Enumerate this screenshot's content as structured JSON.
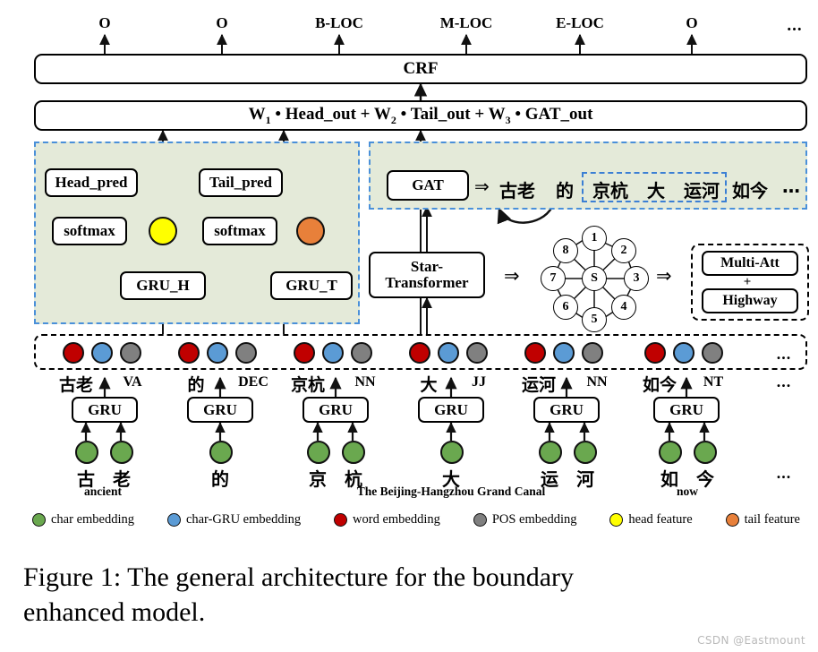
{
  "figure": {
    "caption_line1": "Figure 1:   The general architecture for the boundary",
    "caption_line2": "enhanced model.",
    "watermark": "CSDN @Eastmount"
  },
  "colors": {
    "char_embedding": "#6aa84f",
    "char_gru_embedding": "#5b9bd5",
    "word_embedding": "#c00000",
    "pos_embedding": "#808080",
    "head_feature": "#ffff00",
    "tail_feature": "#e8803a",
    "panel_green": "#e4ead9",
    "dash_blue": "#4a90d9",
    "stroke": "#000000"
  },
  "output_tags": {
    "labels": [
      "O",
      "O",
      "B-LOC",
      "M-LOC",
      "E-LOC",
      "O"
    ],
    "ellipsis": "..."
  },
  "layers": {
    "crf": "CRF",
    "fusion_formula_html": "W<sub>1</sub> • Head_out + W<sub>2</sub> • Tail_out + W<sub>3</sub> • GAT_out"
  },
  "boundary_module": {
    "head_pred": "Head_pred",
    "tail_pred": "Tail_pred",
    "softmax_head": "softmax",
    "softmax_tail": "softmax",
    "gru_h": "GRU_H",
    "gru_t": "GRU_T"
  },
  "gat_module": {
    "gat": "GAT",
    "implies": "⇒",
    "sequence": [
      "古老",
      "的",
      "京杭",
      "大",
      "运河",
      "如今"
    ],
    "entity_span": [
      "京杭",
      "大",
      "运河"
    ],
    "ellipsis": "…"
  },
  "star_transformer": {
    "title_line1": "Star-",
    "title_line2": "Transformer",
    "implies": "⇒",
    "graph": {
      "center_label": "S",
      "ring_labels": [
        "1",
        "2",
        "3",
        "4",
        "5",
        "6",
        "7",
        "8"
      ]
    },
    "attention_block": {
      "top": "Multi-Att",
      "plus": "+",
      "bottom": "Highway"
    }
  },
  "tokens": [
    {
      "word": "古老",
      "pos": "VA",
      "gru": "GRU",
      "chars": [
        "古",
        "老"
      ],
      "gloss": "ancient"
    },
    {
      "word": "的",
      "pos": "DEC",
      "gru": "GRU",
      "chars": [
        "的"
      ],
      "gloss": ""
    },
    {
      "word": "京杭",
      "pos": "NN",
      "gru": "GRU",
      "chars": [
        "京",
        "杭"
      ],
      "gloss": ""
    },
    {
      "word": "大",
      "pos": "JJ",
      "gru": "GRU",
      "chars": [
        "大"
      ],
      "gloss": "The Beijing-Hangzhou Grand Canal"
    },
    {
      "word": "运河",
      "pos": "NN",
      "gru": "GRU",
      "chars": [
        "运",
        "河"
      ],
      "gloss": ""
    },
    {
      "word": "如今",
      "pos": "NT",
      "gru": "GRU",
      "chars": [
        "如",
        "今"
      ],
      "gloss": "now"
    }
  ],
  "token_ellipsis": "...",
  "legend": [
    {
      "label": "char embedding",
      "color": "#6aa84f"
    },
    {
      "label": "char-GRU embedding",
      "color": "#5b9bd5"
    },
    {
      "label": "word embedding",
      "color": "#c00000"
    },
    {
      "label": "POS embedding",
      "color": "#808080"
    },
    {
      "label": "head feature",
      "color": "#ffff00"
    },
    {
      "label": "tail feature",
      "color": "#e8803a"
    }
  ]
}
